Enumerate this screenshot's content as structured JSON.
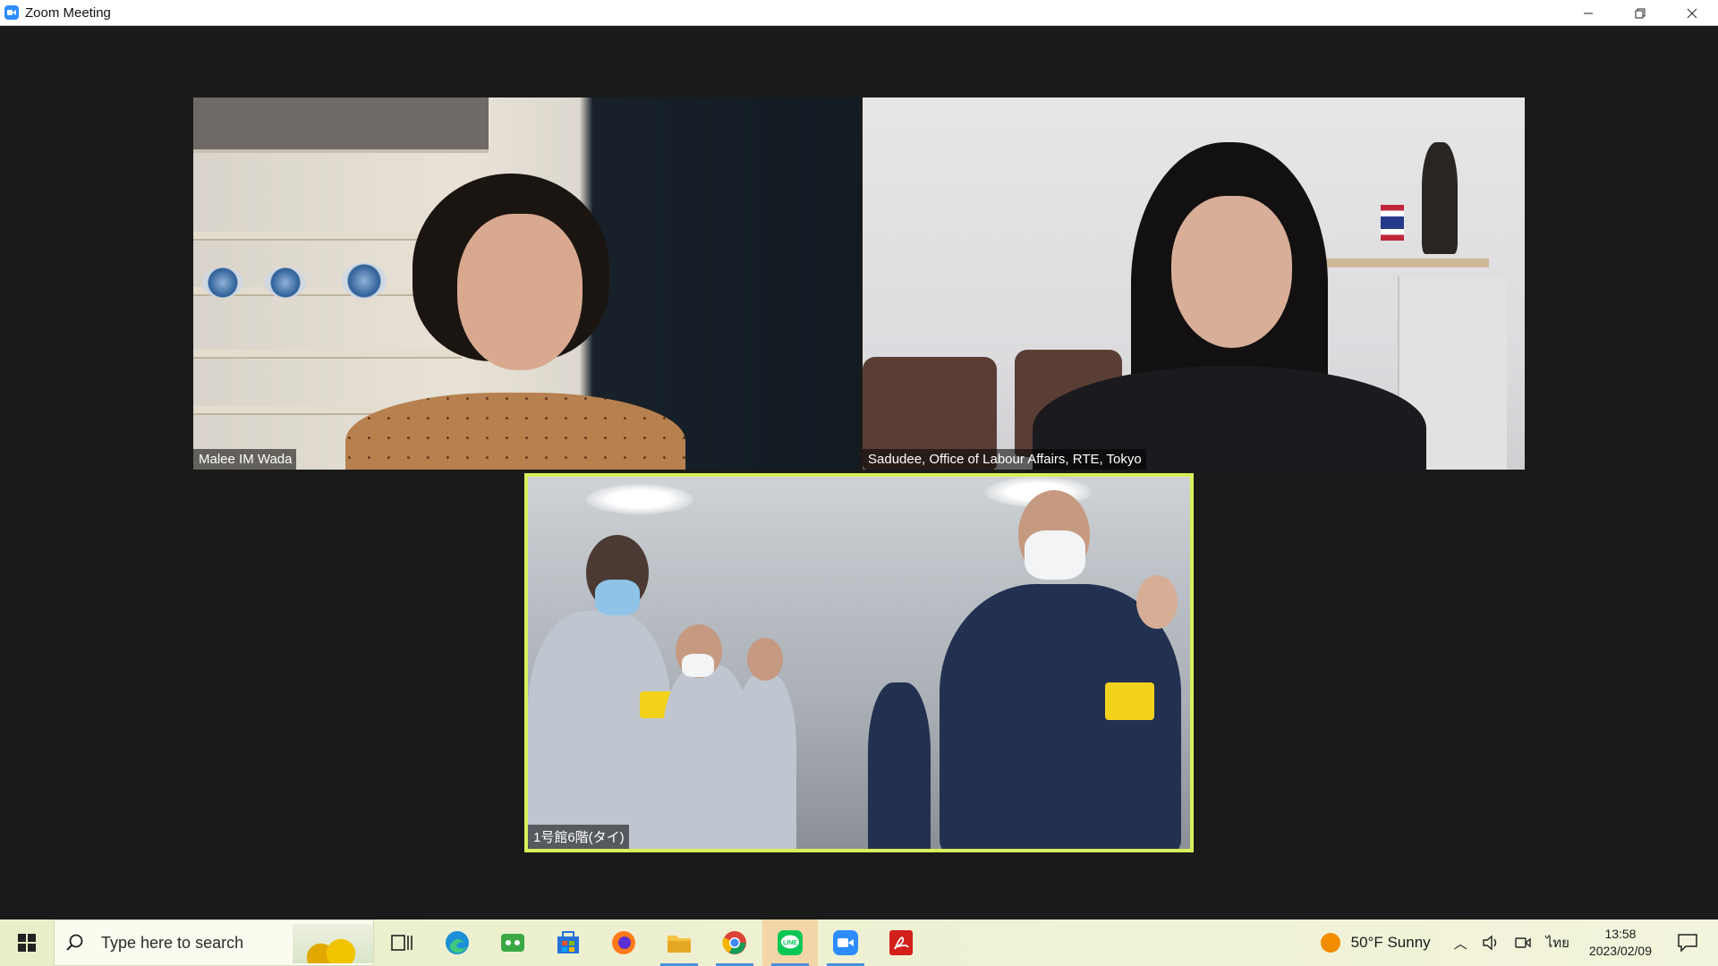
{
  "window": {
    "title": "Zoom Meeting",
    "controls": [
      "minimize-icon",
      "restore-icon",
      "close-icon"
    ]
  },
  "participants": [
    {
      "name": "Malee IM Wada",
      "active_speaker": false
    },
    {
      "name": "Sadudee, Office of Labour Affairs, RTE, Tokyo",
      "active_speaker": false
    },
    {
      "name": "1号館6階(タイ)",
      "active_speaker": true
    }
  ],
  "colors": {
    "active_speaker_border": "#d8f05a",
    "meeting_background": "#1a1a1a",
    "zoom_blue": "#2d8cff"
  },
  "taskbar": {
    "search_placeholder": "Type here to search",
    "apps": [
      "task-view-icon",
      "edge-icon",
      "game-icon",
      "store-icon",
      "firefox-icon",
      "file-explorer-icon",
      "chrome-icon",
      "line-icon",
      "zoom-icon",
      "acrobat-icon"
    ],
    "weather": "50°F  Sunny",
    "input_lang": "ไทย",
    "time": "13:58",
    "date": "2023/02/09"
  }
}
